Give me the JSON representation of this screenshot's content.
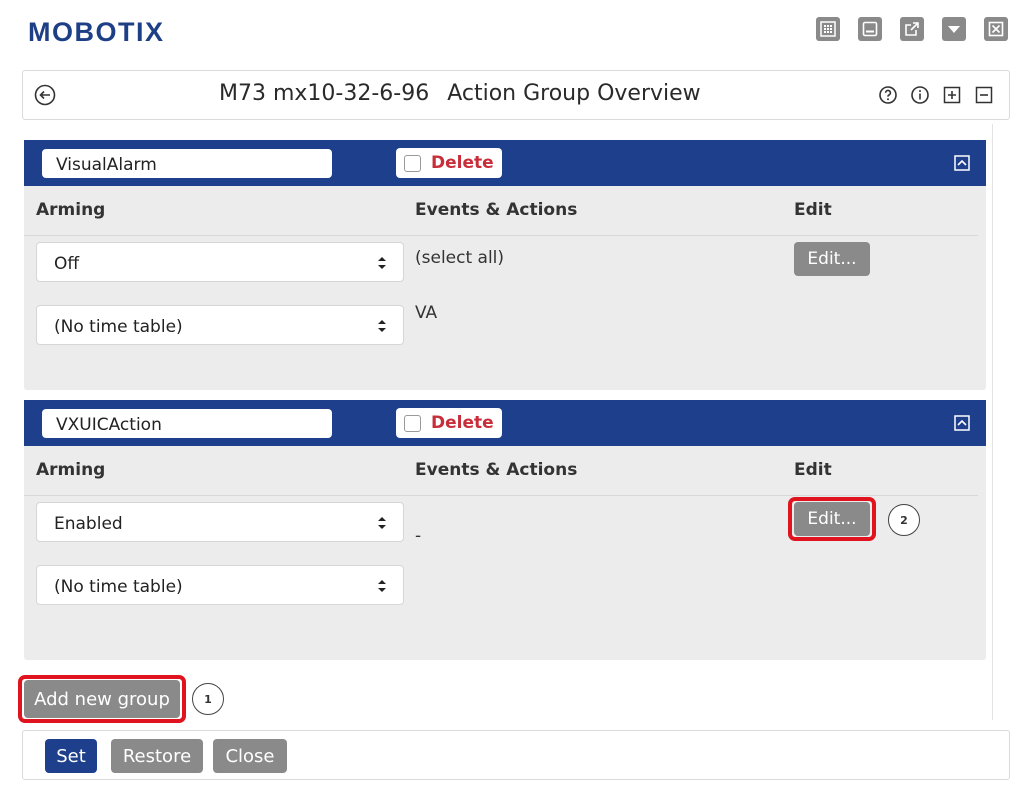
{
  "brand": {
    "logo_text": "MOBOTIX",
    "color": "#1d3f86"
  },
  "window_controls": [
    {
      "icon": "grid-icon"
    },
    {
      "icon": "minimize-icon"
    },
    {
      "icon": "popout-icon"
    },
    {
      "icon": "dropdown-icon"
    },
    {
      "icon": "close-icon"
    }
  ],
  "titlebar": {
    "camera_name": "M73 mx10-32-6-96",
    "page_title": "Action Group Overview",
    "tools": [
      "help-icon",
      "info-icon",
      "expand-all-icon",
      "collapse-all-icon"
    ]
  },
  "columns": {
    "arming": "Arming",
    "events_actions": "Events & Actions",
    "edit": "Edit"
  },
  "groups": [
    {
      "name": "VisualAlarm",
      "delete_label": "Delete",
      "delete_checked": false,
      "arming_value": "Off",
      "timetable_value": "(No time table)",
      "events_lines": [
        "(select all)",
        "VA"
      ],
      "edit_label": "Edit..."
    },
    {
      "name": "VXUICAction",
      "delete_label": "Delete",
      "delete_checked": false,
      "arming_value": "Enabled",
      "timetable_value": "(No time table)",
      "events_lines": [
        "-"
      ],
      "edit_label": "Edit..."
    }
  ],
  "callouts": {
    "add_group": "1",
    "edit_group2": "2"
  },
  "add_group_label": "Add new group",
  "footer": {
    "set_label": "Set",
    "restore_label": "Restore",
    "close_label": "Close"
  },
  "colors": {
    "header_blue": "#1e3f8c",
    "delete_red": "#c82d3a",
    "highlight_red": "#e0141e",
    "button_gray": "#8a8a8a",
    "primary_blue": "#1e3f8c"
  }
}
